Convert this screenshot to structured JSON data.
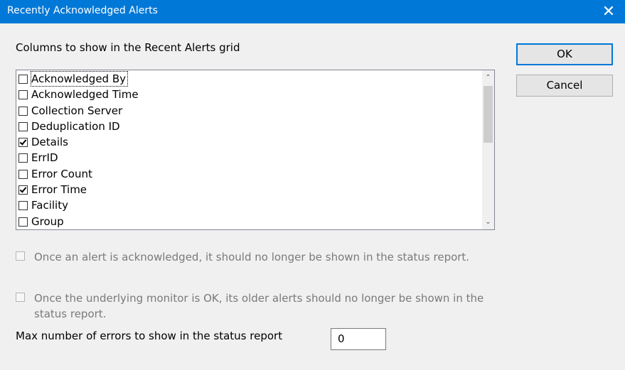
{
  "window": {
    "title": "Recently Acknowledged Alerts",
    "close_glyph": "✕"
  },
  "columns_label": "Columns to show in the Recent Alerts grid",
  "buttons": {
    "ok": "OK",
    "cancel": "Cancel"
  },
  "columns": [
    {
      "label": "Acknowledged By",
      "checked": false,
      "focused": true
    },
    {
      "label": "Acknowledged Time",
      "checked": false
    },
    {
      "label": "Collection Server",
      "checked": false
    },
    {
      "label": "Deduplication ID",
      "checked": false
    },
    {
      "label": "Details",
      "checked": true
    },
    {
      "label": "ErrID",
      "checked": false
    },
    {
      "label": "Error Count",
      "checked": false
    },
    {
      "label": "Error Time",
      "checked": true
    },
    {
      "label": "Facility",
      "checked": false
    },
    {
      "label": "Group",
      "checked": false
    }
  ],
  "scroll": {
    "up": "⌃",
    "down": "⌄"
  },
  "options": {
    "hide_acknowledged": {
      "label": "Once an alert is acknowledged, it should no longer be shown in the status report.",
      "checked": false,
      "enabled": false
    },
    "hide_when_ok": {
      "label": "Once the underlying monitor is OK, its older alerts should no longer be shown in the status report.",
      "checked": false,
      "enabled": false
    }
  },
  "max_errors": {
    "label": "Max number of errors to show in the status report",
    "value": "0"
  }
}
